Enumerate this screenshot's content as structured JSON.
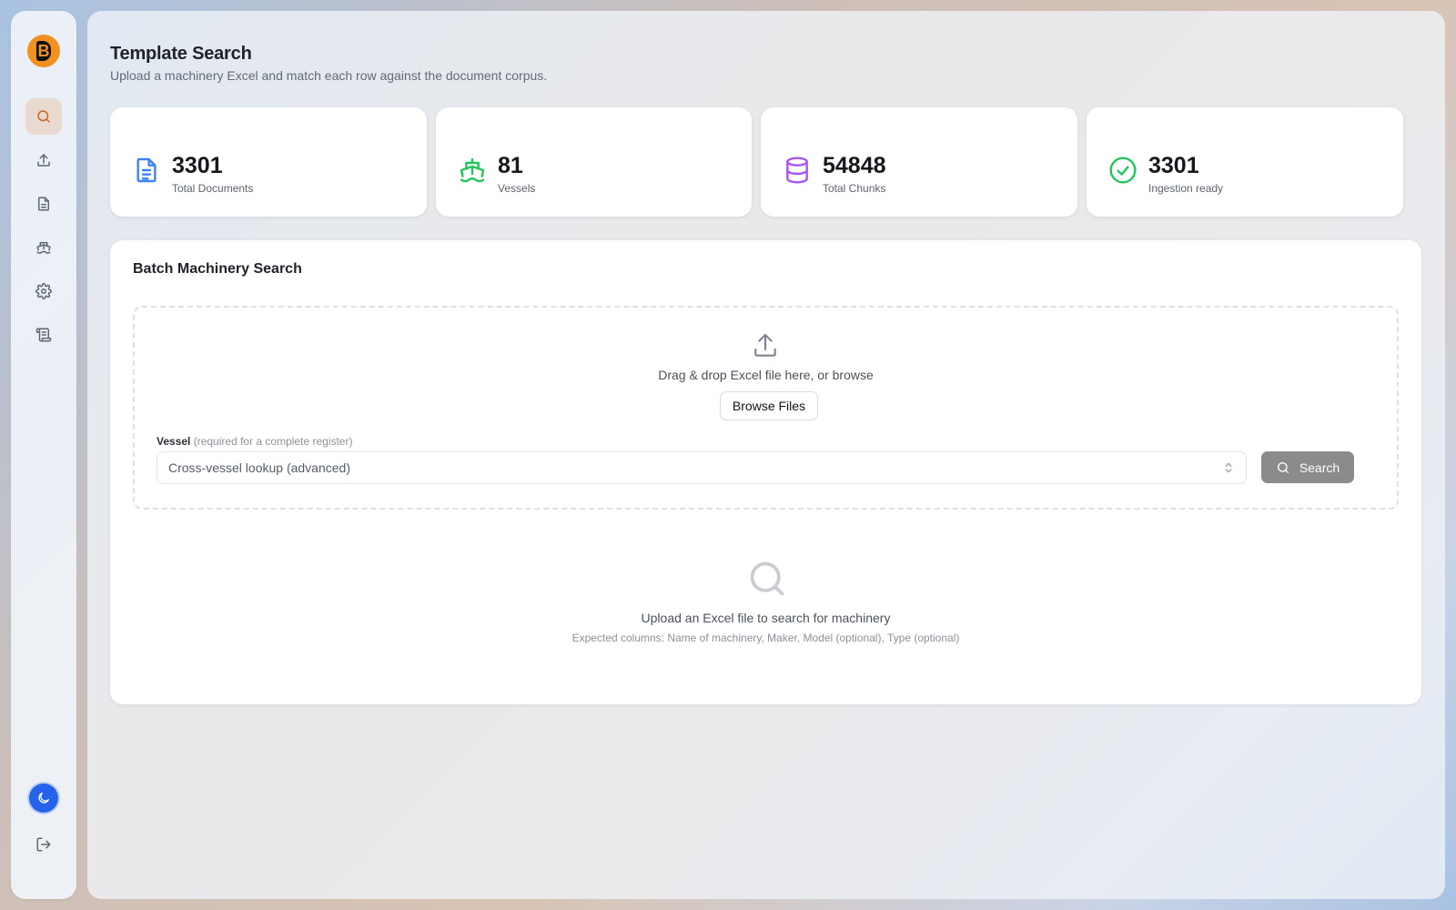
{
  "sidebar": {
    "logo_letter": "B",
    "items": [
      {
        "icon": "search-icon",
        "active": true
      },
      {
        "icon": "upload-icon",
        "active": false
      },
      {
        "icon": "document-icon",
        "active": false
      },
      {
        "icon": "ship-icon",
        "active": false
      },
      {
        "icon": "gear-icon",
        "active": false
      },
      {
        "icon": "scroll-icon",
        "active": false
      }
    ],
    "theme_icon": "moon-icon",
    "logout_icon": "logout-icon"
  },
  "header": {
    "title": "Template Search",
    "subtitle": "Upload a machinery Excel and match each row against the document corpus."
  },
  "stats": [
    {
      "value": "3301",
      "label": "Total Documents",
      "icon": "document-icon",
      "color": "#3b82f6"
    },
    {
      "value": "81",
      "label": "Vessels",
      "icon": "ship-icon",
      "color": "#22c55e"
    },
    {
      "value": "54848",
      "label": "Total Chunks",
      "icon": "database-icon",
      "color": "#a855f7"
    },
    {
      "value": "3301",
      "label": "Ingestion ready",
      "icon": "check-circle-icon",
      "color": "#22c55e"
    }
  ],
  "batch": {
    "title": "Batch Machinery Search",
    "drop_text": "Drag & drop Excel file here, or browse",
    "browse_label": "Browse Files",
    "vessel_label": "Vessel",
    "vessel_hint": "(required for a complete register)",
    "vessel_selected": "Cross-vessel lookup (advanced)",
    "search_label": "Search",
    "empty_title": "Upload an Excel file to search for machinery",
    "empty_sub": "Expected columns: Name of machinery, Maker, Model (optional), Type (optional)"
  }
}
